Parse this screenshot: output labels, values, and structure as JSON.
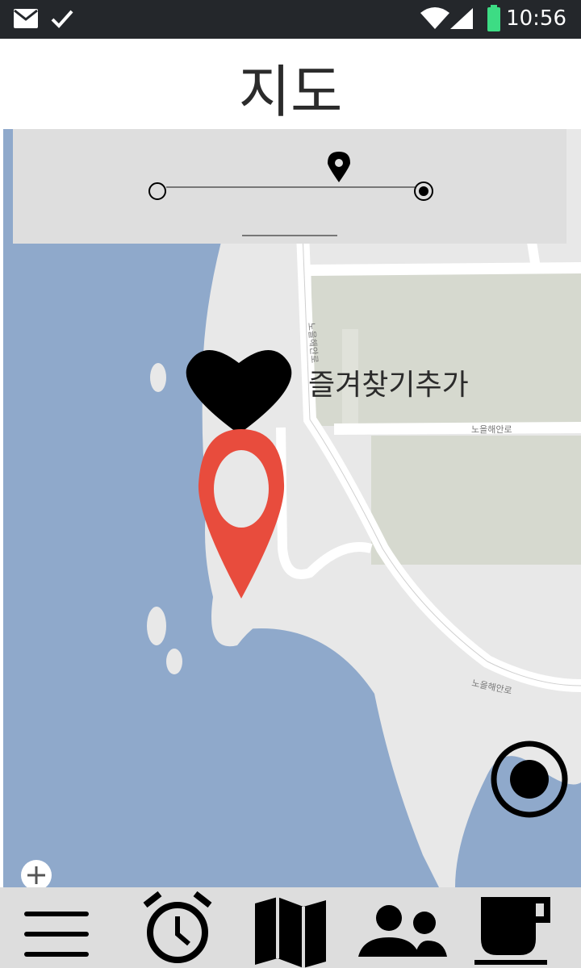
{
  "status_bar": {
    "time": "10:56",
    "icons": [
      "mail-icon",
      "check-icon",
      "wifi-icon",
      "cell-signal-icon",
      "battery-icon"
    ],
    "battery_color": "#3ddc84"
  },
  "header": {
    "title": "지도"
  },
  "map": {
    "water_color": "#8fa9cb",
    "land_color": "#e8e8e8",
    "green_area_color": "#d6d9cf",
    "road_labels": [
      "노을해안로",
      "노을해안로",
      "노을해안로"
    ],
    "favorite_label": "즐겨찾기추가",
    "marker_color": "#e84c3d"
  },
  "route_slider": {
    "start_icon": "circle-outline-icon",
    "end_icon": "radio-selected-icon",
    "current_icon": "location-pin-icon"
  },
  "bottom_nav": {
    "items": [
      "menu-icon",
      "alarm-icon",
      "map-icon",
      "people-icon",
      "coffee-icon"
    ]
  }
}
